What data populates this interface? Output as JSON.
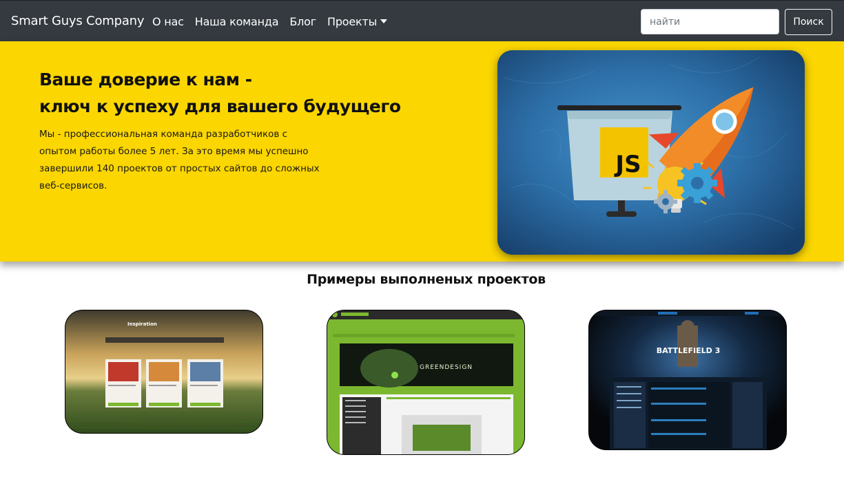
{
  "navbar": {
    "brand": "Smart Guys Company",
    "links": [
      "О нас",
      "Наша команда",
      "Блог",
      "Проекты"
    ],
    "search_placeholder": "найти",
    "search_button": "Поиск"
  },
  "hero": {
    "title_line1": "Ваше доверие к нам -",
    "title_line2": "ключ к успеху для вашего будущего",
    "text": "Мы - профессиональная команда разработчиков с опытом работы более 5 лет. За это время мы успешно завершили 140 проектов от простых сайтов до сложных веб-сервисов.",
    "image_badge": "JS"
  },
  "projects": {
    "title": "Примеры выполненых проектов",
    "items": [
      {
        "caption": "Inspiration"
      },
      {
        "caption": "GREENDESIGN"
      },
      {
        "caption": "BATTLEFIELD 3"
      }
    ]
  },
  "colors": {
    "navbar": "#343a40",
    "hero": "#fbd600",
    "accent_green": "#7cb82f"
  }
}
